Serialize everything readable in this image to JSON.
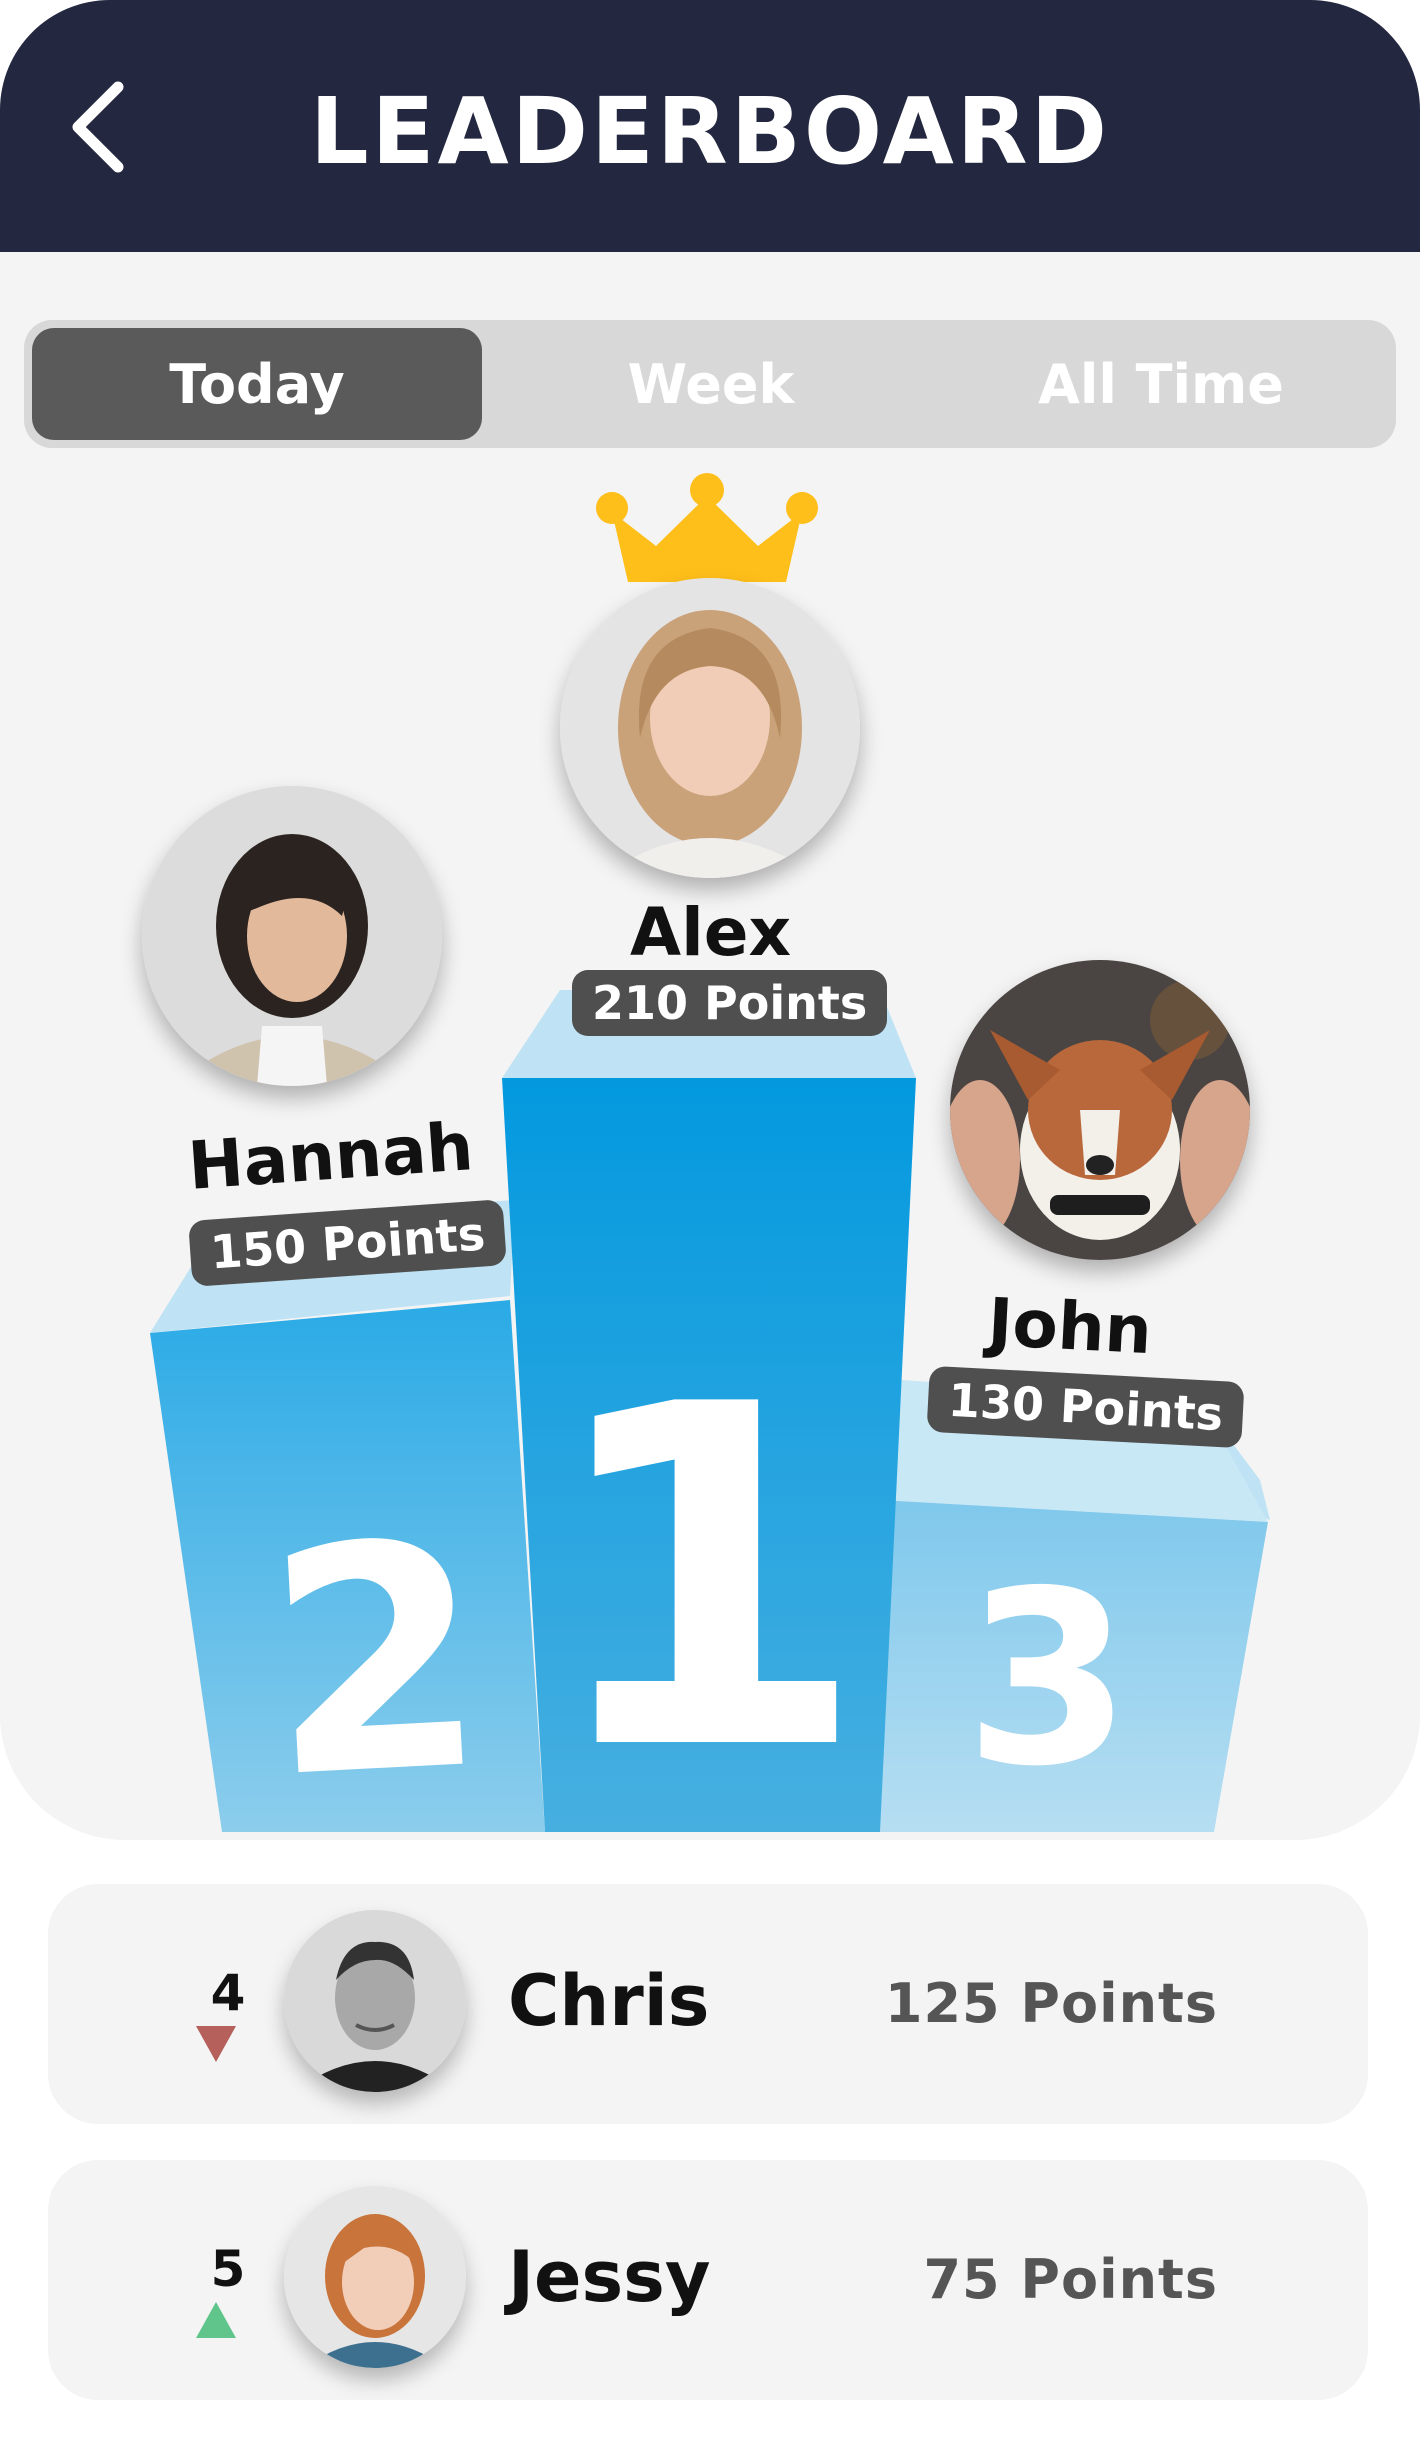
{
  "header": {
    "title": "LEADERBOARD"
  },
  "tabs": [
    {
      "label": "Today",
      "active": true
    },
    {
      "label": "Week",
      "active": false
    },
    {
      "label": "All Time",
      "active": false
    }
  ],
  "podium": {
    "first": {
      "rank": "1",
      "name": "Alex",
      "points": "210 Points"
    },
    "second": {
      "rank": "2",
      "name": "Hannah",
      "points": "150 Points"
    },
    "third": {
      "rank": "3",
      "name": "John",
      "points": "130 Points"
    }
  },
  "list": [
    {
      "rank": "4",
      "trend": "down",
      "name": "Chris",
      "points": "125 Points"
    },
    {
      "rank": "5",
      "trend": "up",
      "name": "Jessy",
      "points": "75 Points"
    }
  ],
  "colors": {
    "header": "#23273f",
    "podium_first": "#0a9ae0",
    "podium_second": "#3bb0e6",
    "podium_third": "#8fcff0",
    "crown": "#ffbf1a",
    "trend_down": "#b5605b",
    "trend_up": "#5fc58a"
  }
}
